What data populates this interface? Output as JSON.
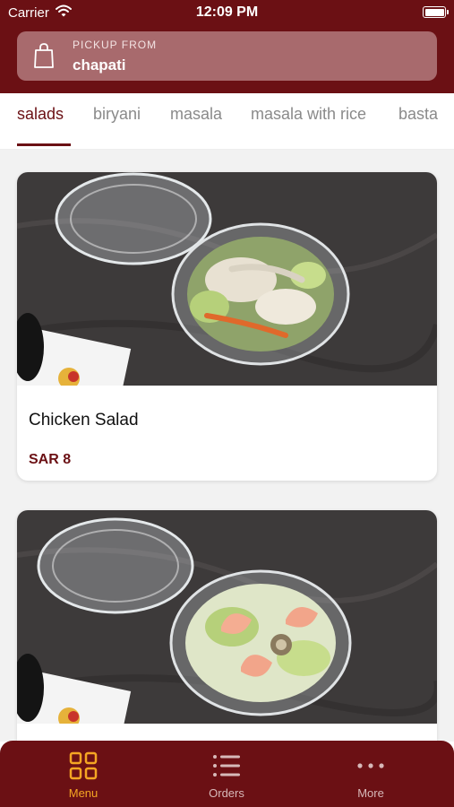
{
  "status_bar": {
    "carrier": "Carrier",
    "time": "12:09 PM"
  },
  "pickup": {
    "label": "PICKUP FROM",
    "store": "chapati",
    "icon": "shopping-bag-icon"
  },
  "tabs": [
    {
      "label": "salads",
      "active": true
    },
    {
      "label": "biryani",
      "active": false
    },
    {
      "label": "masala",
      "active": false
    },
    {
      "label": "masala with rice",
      "active": false
    },
    {
      "label": "basta",
      "active": false
    }
  ],
  "items": [
    {
      "name": "Chicken Salad",
      "price": "SAR 8"
    },
    {
      "name": "",
      "price": ""
    }
  ],
  "nav": {
    "menu": {
      "label": "Menu",
      "icon": "grid-icon",
      "active": true
    },
    "orders": {
      "label": "Orders",
      "icon": "list-icon"
    },
    "more": {
      "label": "More",
      "icon": "more-dots-icon"
    }
  },
  "colors": {
    "brand": "#6b1014",
    "accent": "#f5a623",
    "pickup_box": "#a86a6d"
  }
}
